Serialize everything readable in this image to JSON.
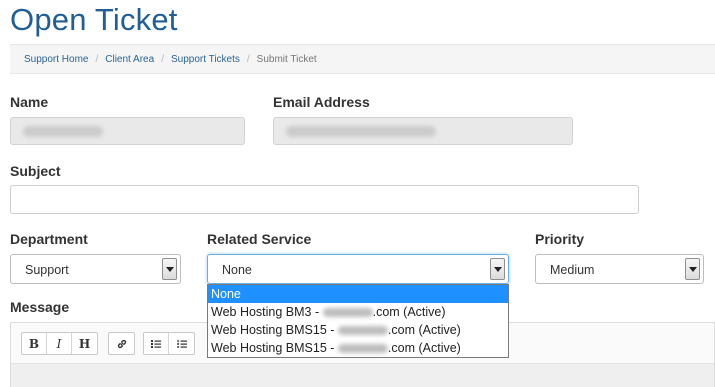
{
  "page": {
    "title": "Open Ticket"
  },
  "breadcrumb": {
    "items": [
      "Support Home",
      "Client Area",
      "Support Tickets"
    ],
    "current": "Submit Ticket"
  },
  "form": {
    "name": {
      "label": "Name",
      "value_hidden": true
    },
    "email": {
      "label": "Email Address",
      "value_hidden": true
    },
    "subject": {
      "label": "Subject",
      "value": ""
    },
    "department": {
      "label": "Department",
      "value": "Support"
    },
    "related_service": {
      "label": "Related Service",
      "value": "None",
      "options": [
        {
          "label": "None",
          "selected": true
        },
        {
          "prefix": "Web Hosting BM3 - ",
          "suffix": ".com (Active)"
        },
        {
          "prefix": "Web Hosting BMS15 - ",
          "suffix": ".com (Active)"
        },
        {
          "prefix": "Web Hosting BMS15 - ",
          "suffix": ".com (Active)"
        }
      ]
    },
    "priority": {
      "label": "Priority",
      "value": "Medium"
    },
    "message": {
      "label": "Message"
    }
  },
  "editor_toolbar": {
    "bold": "B",
    "italic": "I",
    "heading": "H",
    "link_icon": "link-icon",
    "ul_icon": "unordered-list-icon",
    "ol_icon": "ordered-list-icon"
  },
  "colors": {
    "title": "#1f5f96",
    "link": "#2a6496",
    "selected_option": "#1e90ff",
    "focus_border": "#66afe9"
  }
}
